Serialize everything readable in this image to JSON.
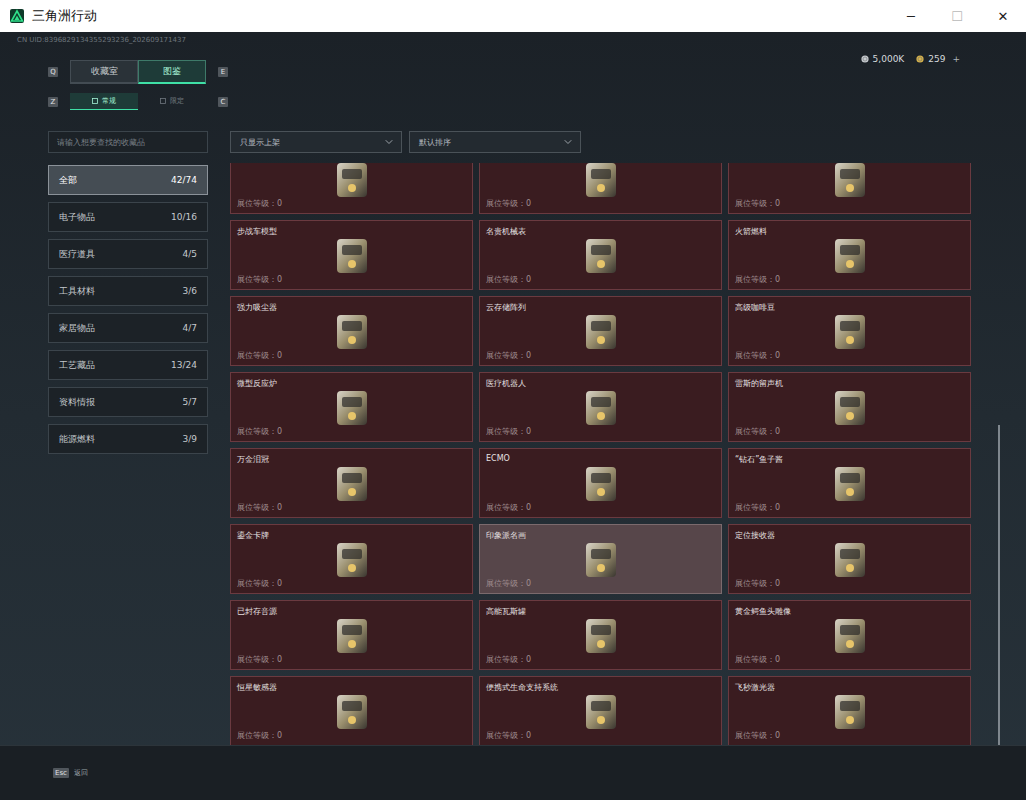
{
  "window": {
    "title": "三角洲行动",
    "controls": [
      {
        "label": "─",
        "disabled": false
      },
      {
        "label": "☐",
        "disabled": true
      },
      {
        "label": "✕",
        "disabled": false
      }
    ]
  },
  "uid": "CN UID:8396829134355293236_202609171437",
  "currency": [
    {
      "amount": "5,000K",
      "kind": "silver",
      "add": ""
    },
    {
      "amount": "259",
      "kind": "gold",
      "add": "+"
    }
  ],
  "tabs": {
    "prev_key": "Q",
    "next_key": "E",
    "items": [
      {
        "label": "收藏室",
        "selected": false
      },
      {
        "label": "图鉴",
        "selected": true
      }
    ]
  },
  "subtabs": {
    "prev_key": "Z",
    "next_key": "C",
    "items": [
      {
        "label": "常规",
        "selected": true
      },
      {
        "label": "限定",
        "selected": false
      }
    ]
  },
  "search": {
    "placeholder": "请输入想要查找的收藏品"
  },
  "categories": [
    {
      "name": "全部",
      "count": "42/74",
      "selected": true
    },
    {
      "name": "电子物品",
      "count": "10/16",
      "selected": false
    },
    {
      "name": "医疗道具",
      "count": "4/5",
      "selected": false
    },
    {
      "name": "工具材料",
      "count": "3/6",
      "selected": false
    },
    {
      "name": "家居物品",
      "count": "4/7",
      "selected": false
    },
    {
      "name": "工艺藏品",
      "count": "13/24",
      "selected": false
    },
    {
      "name": "资料情报",
      "count": "5/7",
      "selected": false
    },
    {
      "name": "能源燃料",
      "count": "3/9",
      "selected": false
    }
  ],
  "filters": [
    {
      "label": "只显示上架"
    },
    {
      "label": "默认排序"
    }
  ],
  "collection": [
    {
      "name": "",
      "display": "展位等级：0",
      "highlighted": false
    },
    {
      "name": "",
      "display": "展位等级：0",
      "highlighted": false
    },
    {
      "name": "",
      "display": "展位等级：0",
      "highlighted": false
    },
    {
      "name": "步战车模型",
      "display": "展位等级：0",
      "highlighted": false
    },
    {
      "name": "名贵机械表",
      "display": "展位等级：0",
      "highlighted": false
    },
    {
      "name": "火箭燃料",
      "display": "展位等级：0",
      "highlighted": false
    },
    {
      "name": "强力吸尘器",
      "display": "展位等级：0",
      "highlighted": false
    },
    {
      "name": "云存储阵列",
      "display": "展位等级：0",
      "highlighted": false
    },
    {
      "name": "高级咖啡豆",
      "display": "展位等级：0",
      "highlighted": false
    },
    {
      "name": "微型反应炉",
      "display": "展位等级：0",
      "highlighted": false
    },
    {
      "name": "医疗机器人",
      "display": "展位等级：0",
      "highlighted": false
    },
    {
      "name": "雷斯的留声机",
      "display": "展位等级：0",
      "highlighted": false
    },
    {
      "name": "万金泪冠",
      "display": "展位等级：0",
      "highlighted": false
    },
    {
      "name": "ECMO",
      "display": "展位等级：0",
      "highlighted": false
    },
    {
      "name": "“钻石”鱼子酱",
      "display": "展位等级：0",
      "highlighted": false
    },
    {
      "name": "鎏金卡牌",
      "display": "展位等级：0",
      "highlighted": false
    },
    {
      "name": "印象派名画",
      "display": "展位等级：0",
      "highlighted": true
    },
    {
      "name": "定位接收器",
      "display": "展位等级：0",
      "highlighted": false
    },
    {
      "name": "已封存音源",
      "display": "展位等级：0",
      "highlighted": false
    },
    {
      "name": "高能瓦斯罐",
      "display": "展位等级：0",
      "highlighted": false
    },
    {
      "name": "黄金鳄鱼头雕像",
      "display": "展位等级：0",
      "highlighted": false
    },
    {
      "name": "恒星敏感器",
      "display": "展位等级：0",
      "highlighted": false
    },
    {
      "name": "便携式生命支持系统",
      "display": "展位等级：0",
      "highlighted": false
    },
    {
      "name": "飞秒激光器",
      "display": "展位等级：0",
      "highlighted": false
    }
  ],
  "scrollbar": {
    "level": 0.55
  },
  "footer": {
    "key": "Esc",
    "label": "返回"
  }
}
